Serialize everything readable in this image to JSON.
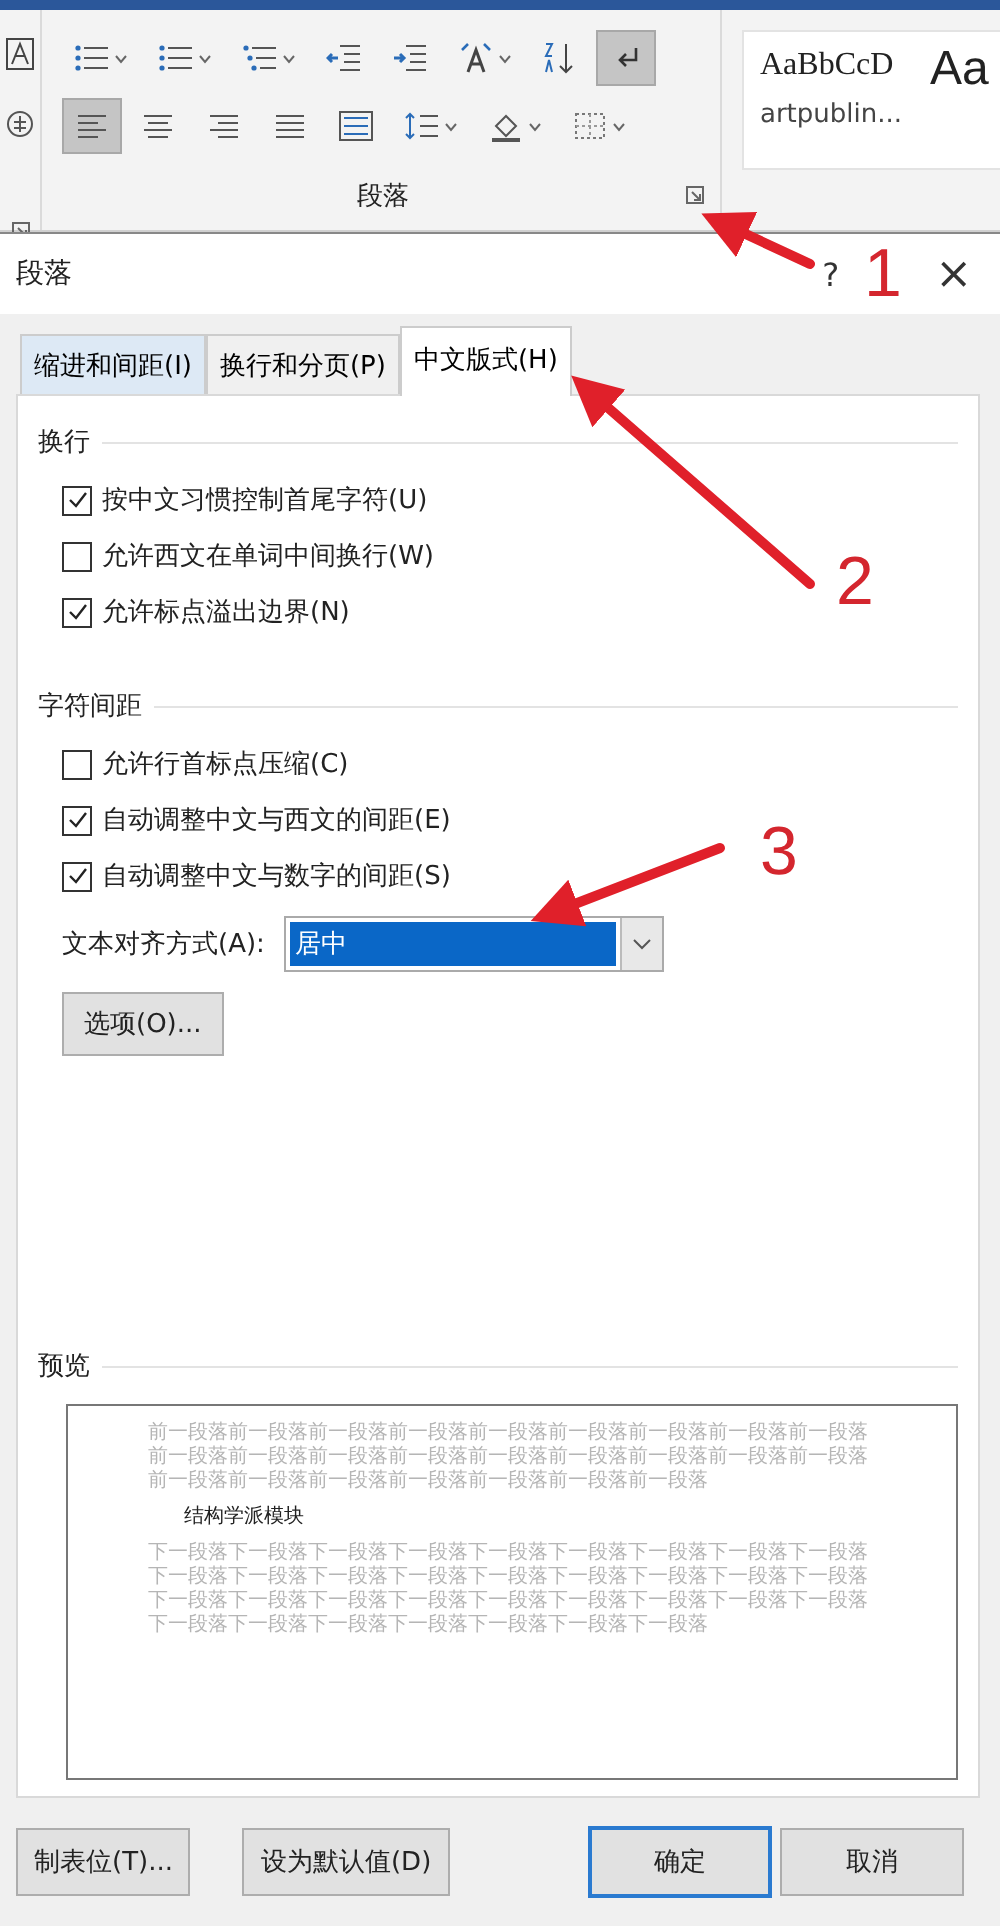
{
  "ribbon": {
    "row_1": [
      {
        "kind": "bullets",
        "dropdown": true,
        "selected": false
      },
      {
        "kind": "numbering",
        "dropdown": true,
        "selected": false
      },
      {
        "kind": "multilevel",
        "dropdown": true,
        "selected": false
      },
      {
        "kind": "outdent",
        "dropdown": false,
        "selected": false
      },
      {
        "kind": "indent",
        "dropdown": false,
        "selected": false
      },
      {
        "kind": "asian-layout",
        "dropdown": true,
        "selected": false
      },
      {
        "kind": "sort",
        "dropdown": false,
        "selected": false
      },
      {
        "kind": "marks",
        "dropdown": false,
        "selected": true
      }
    ],
    "row_2": [
      {
        "kind": "align-left",
        "dropdown": false,
        "selected": true
      },
      {
        "kind": "align-center",
        "dropdown": false,
        "selected": false
      },
      {
        "kind": "align-right",
        "dropdown": false,
        "selected": false
      },
      {
        "kind": "justify",
        "dropdown": false,
        "selected": false
      },
      {
        "kind": "distribute",
        "dropdown": false,
        "selected": false
      },
      {
        "kind": "line-spacing",
        "dropdown": true,
        "selected": false
      },
      {
        "kind": "shading",
        "dropdown": true,
        "selected": false
      },
      {
        "kind": "borders",
        "dropdown": true,
        "selected": false
      }
    ],
    "group_label": "段落",
    "styles": [
      {
        "sample": "AaBbCcD",
        "name": "artpublin..."
      },
      {
        "sample": "Aa"
      }
    ]
  },
  "dialog": {
    "title": "段落",
    "help": "?",
    "close": "×",
    "tabs": [
      {
        "label": "缩进和间距(I)",
        "selected": false
      },
      {
        "label": "换行和分页(P)",
        "selected": false
      },
      {
        "label": "中文版式(H)",
        "selected": true
      }
    ],
    "sections": [
      {
        "title": "换行",
        "options": [
          {
            "label": "按中文习惯控制首尾字符(U)",
            "checked": true
          },
          {
            "label": "允许西文在单词中间换行(W)",
            "checked": false
          },
          {
            "label": "允许标点溢出边界(N)",
            "checked": true
          }
        ]
      },
      {
        "title": "字符间距",
        "options": [
          {
            "label": "允许行首标点压缩(C)",
            "checked": false
          },
          {
            "label": "自动调整中文与西文的间距(E)",
            "checked": true
          },
          {
            "label": "自动调整中文与数字的间距(S)",
            "checked": true
          }
        ]
      }
    ],
    "alignment": {
      "label": "文本对齐方式(A):",
      "value": "居中"
    },
    "options_button": "选项(O)...",
    "preview": {
      "title": "预览",
      "before": "前一段落前一段落前一段落前一段落前一段落前一段落前一段落前一段落前一段落前一段落前一段落前一段落前一段落前一段落前一段落前一段落前一段落前一段落前一段落前一段落前一段落前一段落前一段落前一段落前一段落",
      "sample": "结构学派模块",
      "after": "下一段落下一段落下一段落下一段落下一段落下一段落下一段落下一段落下一段落下一段落下一段落下一段落下一段落下一段落下一段落下一段落下一段落下一段落下一段落下一段落下一段落下一段落下一段落下一段落下一段落下一段落下一段落下一段落下一段落下一段落下一段落下一段落下一段落下一段落"
    },
    "buttons": [
      {
        "label": "制表位(T)...",
        "default": false
      },
      {
        "label": "设为默认值(D)",
        "default": false
      },
      {
        "label": "确定",
        "default": true
      },
      {
        "label": "取消",
        "default": false
      }
    ]
  },
  "annotations": [
    {
      "label": "1"
    },
    {
      "label": "2"
    },
    {
      "label": "3"
    }
  ]
}
